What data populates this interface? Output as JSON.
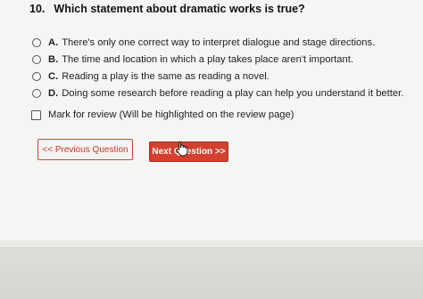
{
  "question": {
    "number": "10.",
    "text": "Which statement about dramatic works is true?"
  },
  "options": [
    {
      "letter": "A.",
      "text": "There's only one correct way to interpret dialogue and stage directions."
    },
    {
      "letter": "B.",
      "text": "The time and location in which a play takes place aren't important."
    },
    {
      "letter": "C.",
      "text": "Reading a play is the same as reading a novel."
    },
    {
      "letter": "D.",
      "text": "Doing some research before reading a play can help you understand it better."
    }
  ],
  "review": {
    "label": "Mark for review (Will be highlighted on the review page)"
  },
  "buttons": {
    "previous_label": "<< Previous Question",
    "next_label": "Next Question >>"
  },
  "colors": {
    "accent": "#d4402f"
  }
}
